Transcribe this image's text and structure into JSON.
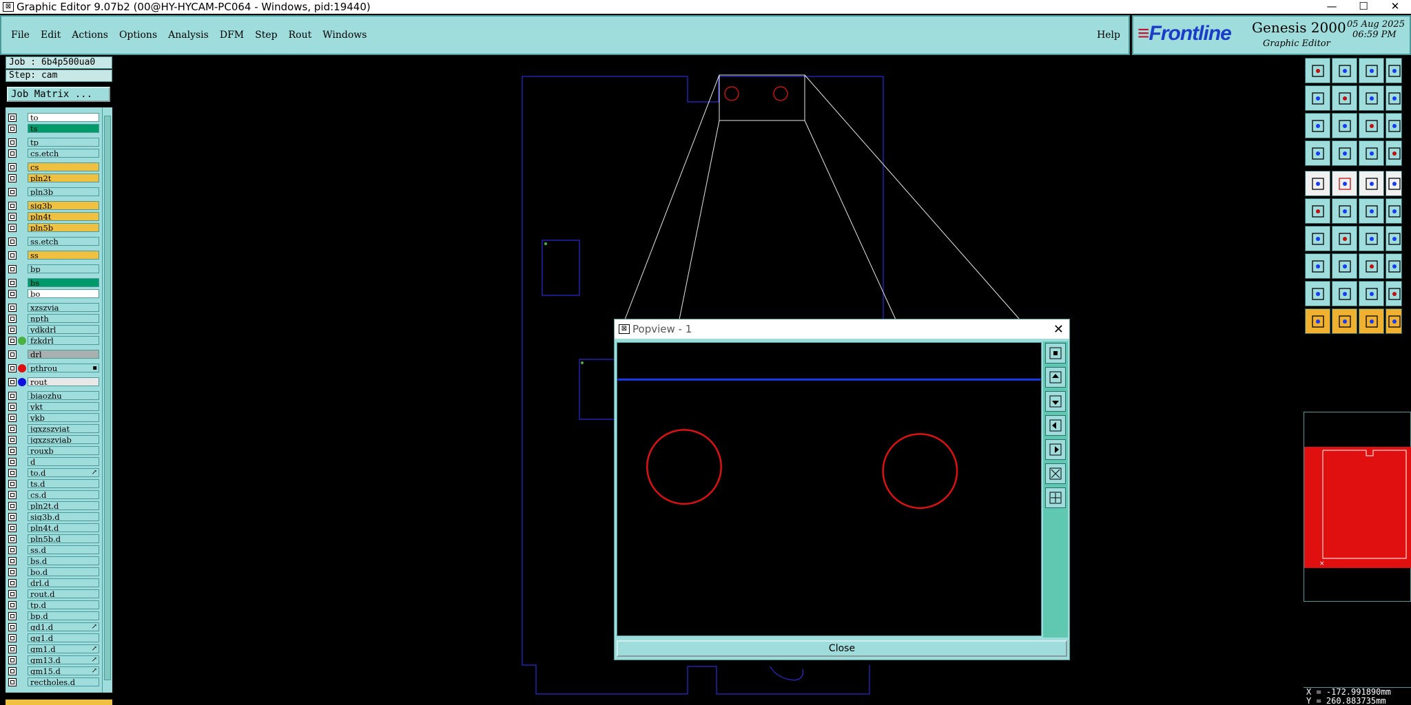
{
  "window": {
    "title": "Graphic Editor 9.07b2 (00@HY-HYCAM-PC064 - Windows, pid:19440)",
    "minimize": "—",
    "maximize": "☐",
    "close": "✕"
  },
  "menu": {
    "items": [
      "File",
      "Edit",
      "Actions",
      "Options",
      "Analysis",
      "DFM",
      "Step",
      "Rout",
      "Windows"
    ],
    "help": "Help"
  },
  "brand": {
    "logo": "Frontline",
    "product": "Genesis 2000",
    "subtitle": "Graphic Editor",
    "date": "05 Aug 2025",
    "time": "06:59 PM"
  },
  "left": {
    "job": "Job : 6b4p500ua0",
    "step": "Step: cam",
    "job_matrix": "Job Matrix ..."
  },
  "layers": [
    {
      "name": "to",
      "color": "#ffffff"
    },
    {
      "name": "ts",
      "color": "#009a6a"
    },
    {
      "name": "tp",
      "color": "#9fdcdc"
    },
    {
      "name": "cs.etch",
      "color": "#9fdcdc"
    },
    {
      "name": "cs",
      "color": "#f0c040"
    },
    {
      "name": "pln2t",
      "color": "#f0c040"
    },
    {
      "name": "pln3b",
      "color": "#9fdcdc"
    },
    {
      "name": "sig3b",
      "color": "#f0c040"
    },
    {
      "name": "pln4t",
      "color": "#f0c040"
    },
    {
      "name": "pln5b",
      "color": "#f0c040"
    },
    {
      "name": "ss.etch",
      "color": "#9fdcdc"
    },
    {
      "name": "ss",
      "color": "#f0c040"
    },
    {
      "name": "bp",
      "color": "#9fdcdc"
    },
    {
      "name": "bs",
      "color": "#009a6a"
    },
    {
      "name": "bo",
      "color": "#ffffff"
    },
    {
      "name": "xzszvia",
      "color": "#9fdcdc"
    },
    {
      "name": "npth",
      "color": "#9fdcdc"
    },
    {
      "name": "ydkdrl",
      "color": "#9fdcdc"
    },
    {
      "name": "fzkdrl",
      "color": "#9fdcdc",
      "dot": "#4ab040"
    },
    {
      "name": "drl",
      "color": "#a8b0b0"
    },
    {
      "name": "pthrou",
      "color": "#9fdcdc",
      "dot": "#e01010",
      "flag": "▪"
    },
    {
      "name": "rout",
      "color": "#e8e8e8",
      "dot": "#1010e0"
    },
    {
      "name": "biaozhu",
      "color": "#9fdcdc"
    },
    {
      "name": "ykt",
      "color": "#9fdcdc"
    },
    {
      "name": "ykb",
      "color": "#9fdcdc"
    },
    {
      "name": "jgxzszviat",
      "color": "#9fdcdc"
    },
    {
      "name": "jgxzszviab",
      "color": "#9fdcdc"
    },
    {
      "name": "rouxb",
      "color": "#9fdcdc"
    },
    {
      "name": "d",
      "color": "#9fdcdc"
    },
    {
      "name": "to.d",
      "color": "#9fdcdc",
      "flag": "↗"
    },
    {
      "name": "ts.d",
      "color": "#9fdcdc"
    },
    {
      "name": "cs.d",
      "color": "#9fdcdc"
    },
    {
      "name": "pln2t.d",
      "color": "#9fdcdc"
    },
    {
      "name": "sig3b.d",
      "color": "#9fdcdc"
    },
    {
      "name": "pln4t.d",
      "color": "#9fdcdc"
    },
    {
      "name": "pln5b.d",
      "color": "#9fdcdc"
    },
    {
      "name": "ss.d",
      "color": "#9fdcdc"
    },
    {
      "name": "bs.d",
      "color": "#9fdcdc"
    },
    {
      "name": "bo.d",
      "color": "#9fdcdc"
    },
    {
      "name": "drl.d",
      "color": "#9fdcdc"
    },
    {
      "name": "rout.d",
      "color": "#9fdcdc"
    },
    {
      "name": "tp.d",
      "color": "#9fdcdc"
    },
    {
      "name": "bp.d",
      "color": "#9fdcdc"
    },
    {
      "name": "gd1.d",
      "color": "#9fdcdc",
      "flag": "↗"
    },
    {
      "name": "gg1.d",
      "color": "#9fdcdc"
    },
    {
      "name": "gm1.d",
      "color": "#9fdcdc",
      "flag": "↗"
    },
    {
      "name": "gm13.d",
      "color": "#9fdcdc",
      "flag": "↗"
    },
    {
      "name": "gm15.d",
      "color": "#9fdcdc",
      "flag": "↗"
    },
    {
      "name": "rectholes.d",
      "color": "#9fdcdc"
    }
  ],
  "popview": {
    "title": "Popview - 1",
    "close_x": "✕",
    "close_label": "Close"
  },
  "status": {
    "x": "X = -172.991890mm",
    "y": "Y =  260.883735mm"
  }
}
